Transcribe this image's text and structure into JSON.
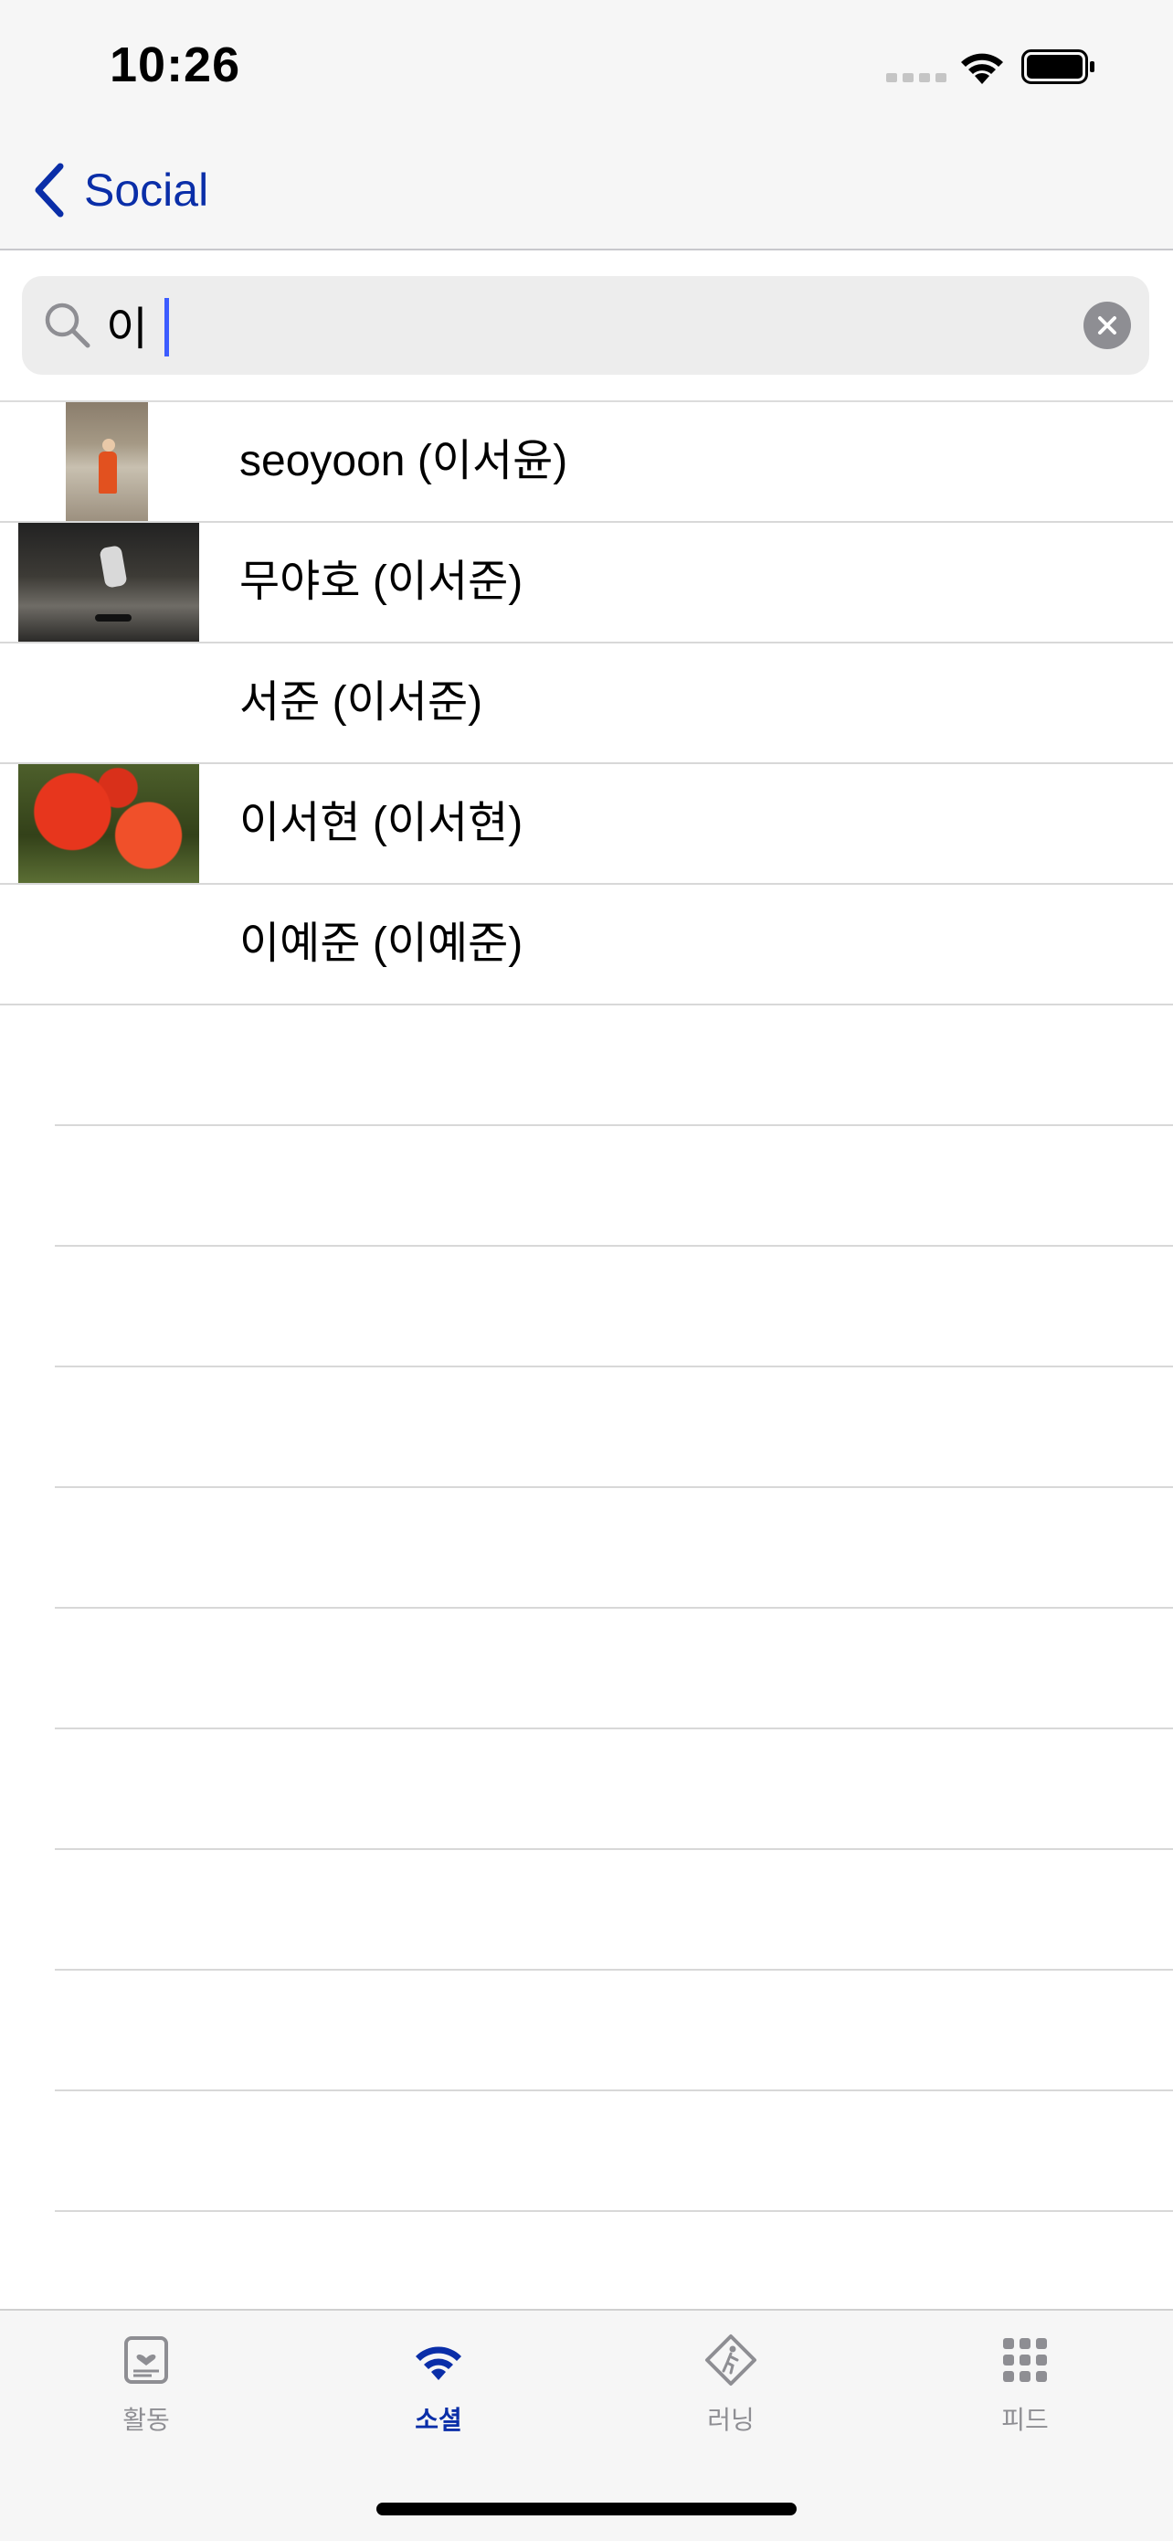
{
  "status_bar": {
    "time": "10:26"
  },
  "nav": {
    "back_label": "Social"
  },
  "search": {
    "value": "이",
    "placeholder": ""
  },
  "results": [
    {
      "label": "seoyoon (이서윤)",
      "has_photo": true
    },
    {
      "label": "무야호 (이서준)",
      "has_photo": true
    },
    {
      "label": "서준 (이서준)",
      "has_photo": false
    },
    {
      "label": "이서현 (이서현)",
      "has_photo": true
    },
    {
      "label": "이예준 (이예준)",
      "has_photo": false
    }
  ],
  "tabs": [
    {
      "label": "활동",
      "icon": "activity-card-icon",
      "active": false
    },
    {
      "label": "소셜",
      "icon": "wifi-icon",
      "active": true
    },
    {
      "label": "러닝",
      "icon": "running-sign-icon",
      "active": false
    },
    {
      "label": "피드",
      "icon": "grid-icon",
      "active": false
    }
  ],
  "colors": {
    "accent": "#0a2ea8",
    "caret": "#3c5cff",
    "inactive": "#8e8e93"
  }
}
